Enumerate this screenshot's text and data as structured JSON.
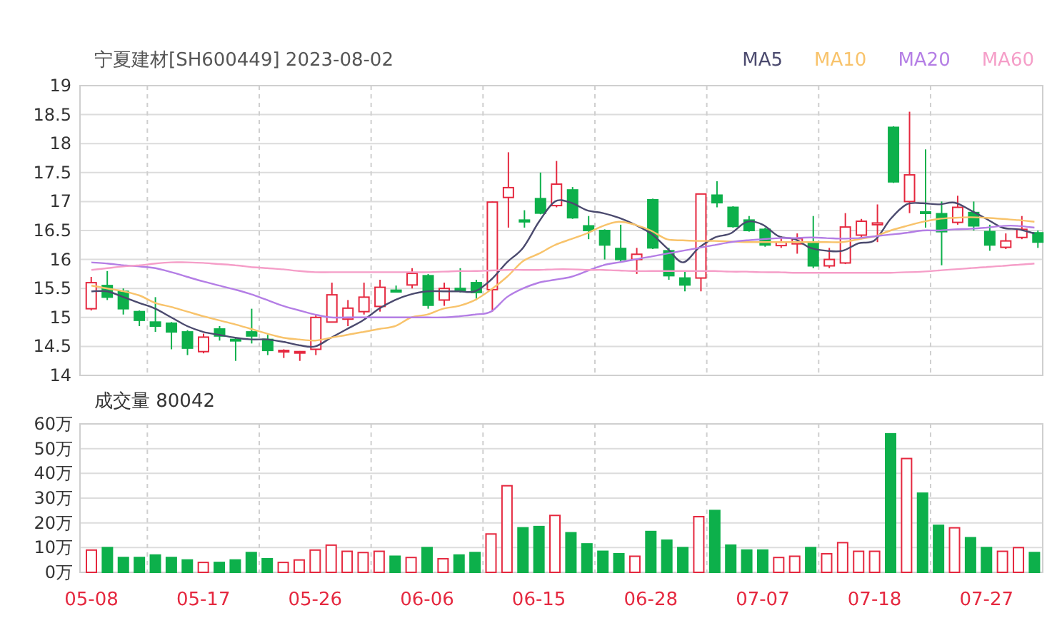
{
  "header": {
    "title": "宁夏建材[SH600449] 2023-08-02"
  },
  "price_chart": {
    "candles": {
      "chart_data": {
        "type": "candlestick",
        "grid": true,
        "ylim": [
          14,
          19
        ],
        "yticks": [
          14,
          14.5,
          15,
          15.5,
          16,
          16.5,
          17,
          17.5,
          18,
          18.5,
          19
        ],
        "categories": [
          null,
          null,
          null,
          null,
          null,
          null,
          null,
          null,
          null,
          null,
          null,
          null,
          null,
          null,
          null,
          null,
          null,
          null,
          null,
          null,
          null,
          null,
          null,
          null,
          null,
          null,
          null,
          null,
          null,
          null,
          null,
          null,
          null,
          null,
          null,
          null,
          null,
          null,
          null,
          null,
          null,
          null,
          null,
          null,
          null,
          null,
          null,
          null,
          null,
          null,
          null,
          null,
          null,
          null,
          null,
          null,
          null,
          null,
          null,
          null
        ],
        "ohlc": [
          [
            15.15,
            15.7,
            15.12,
            15.6
          ],
          [
            15.55,
            15.8,
            15.3,
            15.35
          ],
          [
            15.45,
            15.5,
            15.05,
            15.15
          ],
          [
            15.1,
            15.12,
            14.85,
            14.95
          ],
          [
            14.92,
            15.35,
            14.75,
            14.85
          ],
          [
            14.9,
            14.92,
            14.45,
            14.75
          ],
          [
            14.75,
            14.78,
            14.35,
            14.47
          ],
          [
            14.41,
            14.72,
            14.38,
            14.66
          ],
          [
            14.8,
            14.85,
            14.6,
            14.68
          ],
          [
            14.62,
            14.65,
            14.25,
            14.6
          ],
          [
            14.75,
            15.15,
            14.55,
            14.68
          ],
          [
            14.62,
            14.7,
            14.35,
            14.43
          ],
          [
            14.41,
            14.45,
            14.3,
            14.43
          ],
          [
            14.39,
            14.42,
            14.25,
            14.41
          ],
          [
            14.45,
            15.05,
            14.35,
            15.0
          ],
          [
            14.92,
            15.6,
            14.92,
            15.39
          ],
          [
            14.97,
            15.3,
            14.85,
            15.16
          ],
          [
            15.1,
            15.6,
            15.05,
            15.35
          ],
          [
            15.19,
            15.65,
            15.1,
            15.52
          ],
          [
            15.47,
            15.55,
            15.43,
            15.44
          ],
          [
            15.56,
            15.85,
            15.5,
            15.76
          ],
          [
            15.72,
            15.75,
            15.15,
            15.21
          ],
          [
            15.3,
            15.6,
            15.2,
            15.5
          ],
          [
            15.5,
            15.85,
            15.43,
            15.46
          ],
          [
            15.6,
            15.65,
            15.3,
            15.43
          ],
          [
            15.48,
            17.0,
            15.1,
            16.99
          ],
          [
            17.07,
            17.85,
            16.55,
            17.24
          ],
          [
            16.68,
            16.85,
            16.55,
            16.65
          ],
          [
            17.05,
            17.5,
            16.78,
            16.8
          ],
          [
            16.93,
            17.7,
            16.9,
            17.3
          ],
          [
            17.2,
            17.25,
            16.7,
            16.72
          ],
          [
            16.58,
            16.75,
            16.35,
            16.5
          ],
          [
            16.5,
            16.52,
            16.0,
            16.25
          ],
          [
            16.19,
            16.6,
            15.95,
            16.0
          ],
          [
            16.0,
            16.2,
            15.75,
            16.09
          ],
          [
            17.03,
            17.05,
            16.18,
            16.2
          ],
          [
            16.15,
            16.2,
            15.65,
            15.72
          ],
          [
            15.68,
            15.8,
            15.45,
            15.56
          ],
          [
            15.68,
            17.13,
            15.45,
            17.13
          ],
          [
            17.11,
            17.35,
            16.9,
            16.98
          ],
          [
            16.9,
            16.92,
            16.55,
            16.57
          ],
          [
            16.68,
            16.75,
            16.48,
            16.5
          ],
          [
            16.52,
            16.55,
            16.22,
            16.25
          ],
          [
            16.24,
            16.4,
            16.2,
            16.3
          ],
          [
            16.27,
            16.45,
            16.1,
            16.36
          ],
          [
            16.3,
            16.75,
            15.85,
            15.89
          ],
          [
            15.89,
            16.2,
            15.85,
            16.0
          ],
          [
            15.94,
            16.8,
            15.92,
            16.56
          ],
          [
            16.42,
            16.7,
            16.35,
            16.66
          ],
          [
            16.6,
            16.95,
            16.3,
            16.63
          ],
          [
            18.28,
            18.3,
            17.32,
            17.34
          ],
          [
            17.0,
            18.55,
            16.8,
            17.46
          ],
          [
            16.82,
            17.9,
            16.55,
            16.8
          ],
          [
            16.79,
            17.0,
            15.9,
            16.48
          ],
          [
            16.64,
            17.1,
            16.6,
            16.9
          ],
          [
            16.81,
            17.0,
            16.5,
            16.58
          ],
          [
            16.48,
            16.6,
            16.15,
            16.25
          ],
          [
            16.21,
            16.45,
            16.18,
            16.32
          ],
          [
            16.38,
            16.75,
            16.35,
            16.52
          ],
          [
            16.46,
            16.5,
            16.2,
            16.3
          ]
        ]
      }
    },
    "averages": {
      "chart_data": {
        "type": "line",
        "ylim": [
          14,
          19
        ],
        "series": [
          {
            "name": "MA5",
            "color": "#4b4a6e",
            "values": [
              15.45,
              15.45,
              15.35,
              15.25,
              15.15,
              15.0,
              14.85,
              14.75,
              14.7,
              14.65,
              14.62,
              14.62,
              14.58,
              14.52,
              14.5,
              14.65,
              14.8,
              14.95,
              15.15,
              15.3,
              15.4,
              15.45,
              15.45,
              15.45,
              15.45,
              15.65,
              15.95,
              16.2,
              16.65,
              17.0,
              16.98,
              16.85,
              16.8,
              16.72,
              16.6,
              16.45,
              16.2,
              15.95,
              16.2,
              16.38,
              16.45,
              16.65,
              16.6,
              16.4,
              16.35,
              16.2,
              16.15,
              16.15,
              16.28,
              16.33,
              16.7,
              16.95,
              16.97,
              16.95,
              16.98,
              16.85,
              16.7,
              16.55,
              16.52,
              16.45
            ]
          },
          {
            "name": "MA10",
            "color": "#f8c36b",
            "values": [
              15.55,
              15.5,
              15.45,
              15.38,
              15.25,
              15.18,
              15.1,
              15.02,
              14.95,
              14.88,
              14.8,
              14.72,
              14.65,
              14.62,
              14.6,
              14.65,
              14.7,
              14.75,
              14.8,
              14.85,
              15.0,
              15.05,
              15.15,
              15.2,
              15.3,
              15.48,
              15.7,
              15.97,
              16.1,
              16.25,
              16.35,
              16.45,
              16.58,
              16.65,
              16.6,
              16.5,
              16.35,
              16.33,
              16.32,
              16.32,
              16.31,
              16.3,
              16.3,
              16.3,
              16.3,
              16.3,
              16.3,
              16.3,
              16.35,
              16.4,
              16.5,
              16.58,
              16.65,
              16.7,
              16.72,
              16.73,
              16.72,
              16.7,
              16.68,
              16.65
            ]
          },
          {
            "name": "MA20",
            "color": "#b47ee5",
            "values": [
              15.95,
              15.93,
              15.9,
              15.88,
              15.85,
              15.78,
              15.7,
              15.62,
              15.55,
              15.48,
              15.4,
              15.3,
              15.2,
              15.12,
              15.05,
              15.0,
              15.0,
              15.0,
              15.0,
              15.0,
              15.0,
              15.0,
              15.0,
              15.02,
              15.05,
              15.1,
              15.35,
              15.5,
              15.6,
              15.65,
              15.7,
              15.8,
              15.9,
              15.95,
              16.0,
              16.05,
              16.1,
              16.15,
              16.2,
              16.25,
              16.3,
              16.33,
              16.35,
              16.37,
              16.37,
              16.38,
              16.37,
              16.36,
              16.37,
              16.4,
              16.43,
              16.46,
              16.5,
              16.5,
              16.52,
              16.53,
              16.55,
              16.58,
              16.58,
              16.55
            ]
          },
          {
            "name": "MA60",
            "color": "#f59ec8",
            "values": [
              15.82,
              15.85,
              15.88,
              15.9,
              15.93,
              15.95,
              15.95,
              15.94,
              15.92,
              15.9,
              15.87,
              15.85,
              15.83,
              15.8,
              15.78,
              15.78,
              15.78,
              15.78,
              15.78,
              15.78,
              15.78,
              15.78,
              15.79,
              15.8,
              15.8,
              15.81,
              15.82,
              15.82,
              15.82,
              15.83,
              15.83,
              15.82,
              15.82,
              15.81,
              15.8,
              15.8,
              15.8,
              15.8,
              15.8,
              15.8,
              15.79,
              15.79,
              15.78,
              15.78,
              15.77,
              15.77,
              15.77,
              15.77,
              15.77,
              15.77,
              15.77,
              15.78,
              15.79,
              15.81,
              15.83,
              15.85,
              15.87,
              15.89,
              15.91,
              15.93
            ]
          }
        ]
      }
    }
  },
  "volume_chart": {
    "label": "成交量 80042",
    "chart_data": {
      "type": "bar",
      "grid": true,
      "ylim": [
        0,
        60
      ],
      "yticks": [
        {
          "value": 0,
          "label": "0万"
        },
        {
          "value": 10,
          "label": "10万"
        },
        {
          "value": 20,
          "label": "20万"
        },
        {
          "value": 30,
          "label": "30万"
        },
        {
          "value": 40,
          "label": "40万"
        },
        {
          "value": 50,
          "label": "50万"
        },
        {
          "value": 60,
          "label": "60万"
        }
      ],
      "categories": [
        "05-08",
        null,
        null,
        null,
        null,
        null,
        null,
        "05-17",
        null,
        null,
        null,
        null,
        null,
        null,
        "05-26",
        null,
        null,
        null,
        null,
        null,
        null,
        "06-06",
        null,
        null,
        null,
        null,
        null,
        null,
        "06-15",
        null,
        null,
        null,
        null,
        null,
        null,
        "06-28",
        null,
        null,
        null,
        null,
        null,
        null,
        "07-07",
        null,
        null,
        null,
        null,
        null,
        null,
        "07-18",
        null,
        null,
        null,
        null,
        null,
        null,
        "07-27",
        null,
        null,
        null
      ],
      "values": [
        9,
        10,
        6,
        6,
        7,
        6,
        5,
        4,
        4,
        5,
        8,
        5.5,
        4,
        5,
        9,
        11,
        8.5,
        8,
        8.5,
        6.5,
        6,
        10,
        5.5,
        7,
        8,
        15.5,
        35,
        18,
        18.5,
        23,
        16,
        11.5,
        8.5,
        7.5,
        6.5,
        16.5,
        13,
        10,
        22.5,
        25,
        11,
        9,
        9,
        6,
        6.5,
        10,
        7.5,
        12,
        8.5,
        8.5,
        56,
        46,
        32,
        19,
        18,
        14,
        10,
        8.5,
        10,
        8
      ]
    }
  }
}
